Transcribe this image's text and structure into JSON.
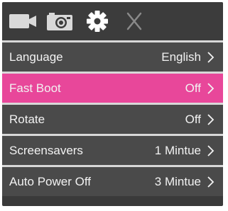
{
  "toolbar": {
    "icons": [
      "video-camera-icon",
      "photo-camera-icon",
      "gear-icon",
      "close-icon"
    ],
    "active_icon": "gear-icon"
  },
  "colors": {
    "background": "#4a4a4a",
    "selected": "#e8479a",
    "divider": "#d8d8d8",
    "text": "#f2f2f2"
  },
  "menu": {
    "items": [
      {
        "label": "Language",
        "value": "English",
        "selected": false
      },
      {
        "label": "Fast Boot",
        "value": "Off",
        "selected": true
      },
      {
        "label": "Rotate",
        "value": "Off",
        "selected": false
      },
      {
        "label": "Screensavers",
        "value": "1 Mintue",
        "selected": false
      },
      {
        "label": "Auto Power Off",
        "value": "3 Mintue",
        "selected": false
      }
    ]
  }
}
